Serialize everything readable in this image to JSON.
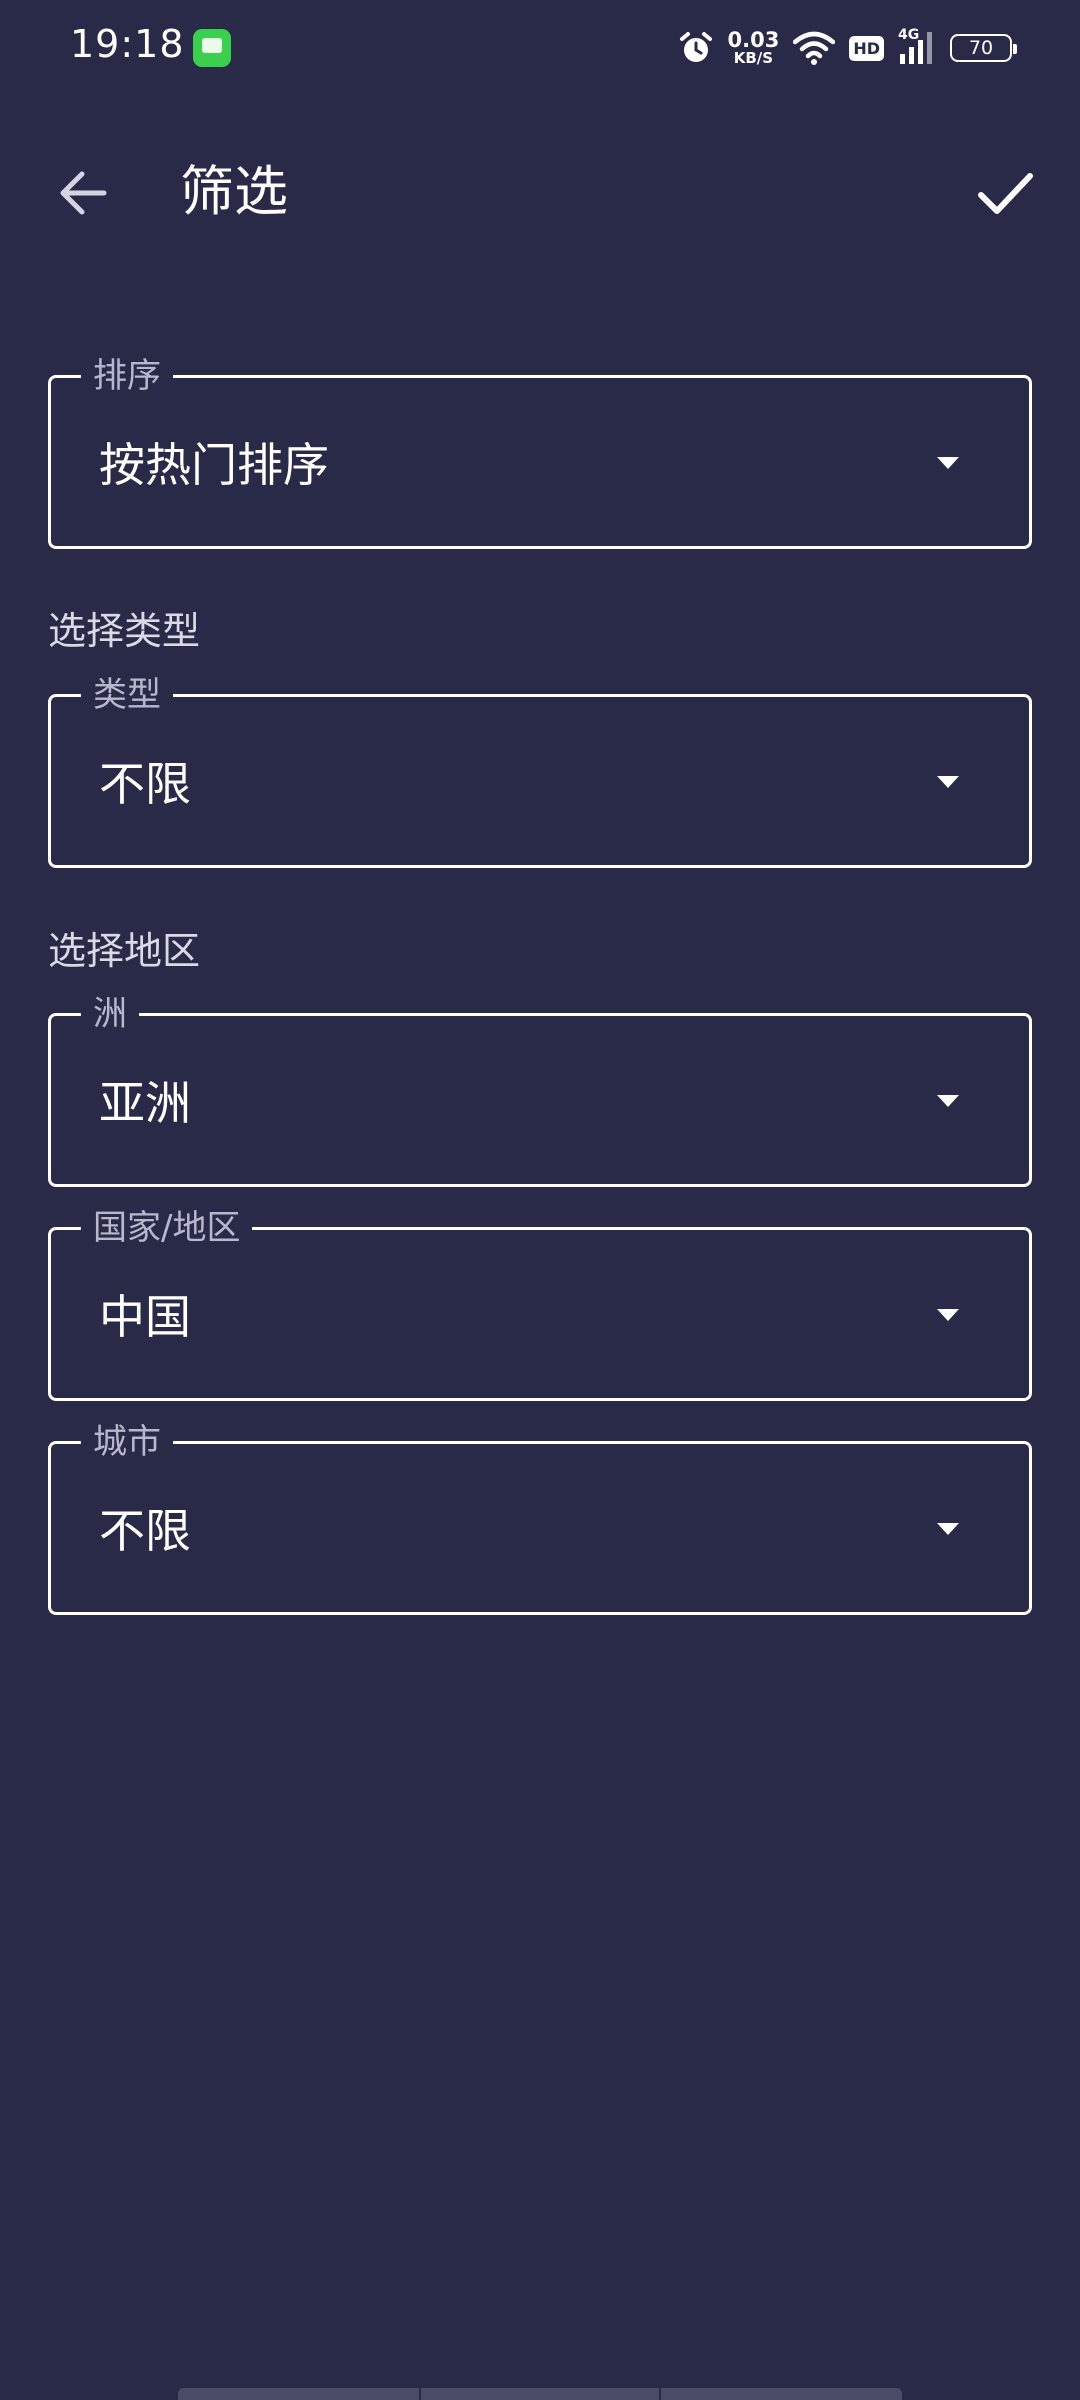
{
  "status_bar": {
    "time": "19:18",
    "net_speed_value": "0.03",
    "net_speed_unit": "KB/S",
    "hd_label": "HD",
    "network_type": "4G",
    "battery_level": "70"
  },
  "header": {
    "title": "筛选"
  },
  "fields": {
    "sort": {
      "label": "排序",
      "value": "按热门排序"
    },
    "type": {
      "label": "类型",
      "value": "不限"
    },
    "continent": {
      "label": "洲",
      "value": "亚洲"
    },
    "country": {
      "label": "国家/地区",
      "value": "中国"
    },
    "city": {
      "label": "城市",
      "value": "不限"
    }
  },
  "sections": {
    "type_heading": "选择类型",
    "region_heading": "选择地区"
  }
}
